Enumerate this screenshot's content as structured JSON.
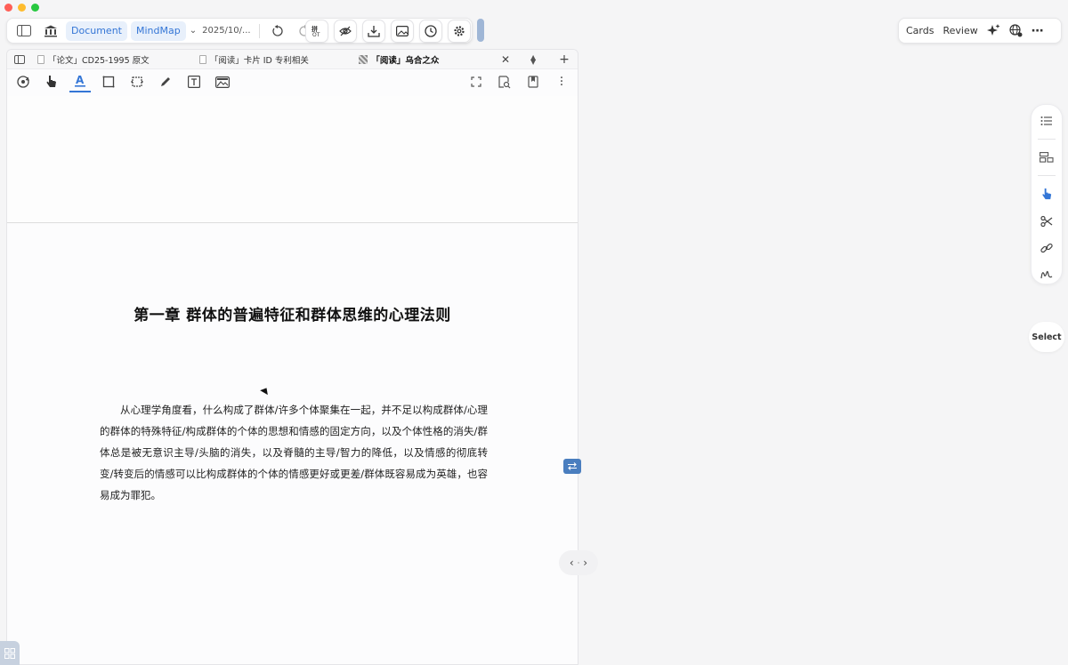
{
  "toolbar": {
    "document_label": "Document",
    "mindmap_label": "MindMap",
    "date_label": "2025/10/..."
  },
  "right_toolbar": {
    "cards_label": "Cards",
    "review_label": "Review"
  },
  "tabs": [
    {
      "label": "「论文」CD25-1995 原文"
    },
    {
      "label": "「阅读」卡片 ID 专利相关"
    },
    {
      "label": "「阅读」乌合之众"
    }
  ],
  "document": {
    "chapter_title": "第一章 群体的普遍特征和群体思维的心理法则",
    "paragraph": "从心理学角度看，什么构成了群体/许多个体聚集在一起，并不足以构成群体/心理的群体的特殊特征/构成群体的个体的思想和情感的固定方向，以及个体性格的消失/群体总是被无意识主导/头脑的消失，以及脊髓的主导/智力的降低，以及情感的彻底转变/转变后的情感可以比构成群体的个体的情感更好或更差/群体既容易成为英雄，也容易成为罪犯。"
  },
  "side_panel": {
    "select_label": "Select"
  },
  "colors": {
    "accent": "#3476d6",
    "swap_button": "#4a7ebf"
  }
}
